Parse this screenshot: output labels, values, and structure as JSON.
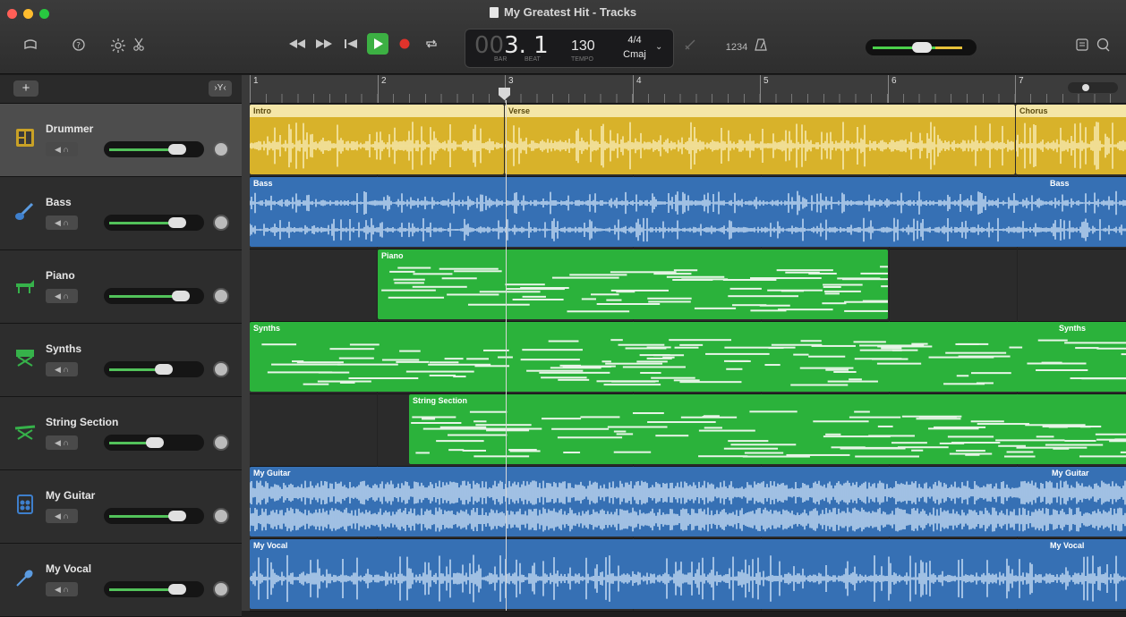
{
  "window": {
    "title": "My Greatest Hit - Tracks"
  },
  "colors": {
    "drummer": "#d8b22a",
    "audio": "#3670b4",
    "midi": "#2bb23b",
    "record": "#e0332b",
    "play": "#3cb043"
  },
  "toolbar": {
    "left_icons": [
      "library-icon",
      "help-icon",
      "smart-controls-icon",
      "editors-icon"
    ],
    "right_icons": [
      "notepad-icon",
      "loops-icon"
    ]
  },
  "lcd": {
    "bar_dim": "00",
    "position": "3. 1",
    "bar_label": "BAR",
    "beat_label": "BEAT",
    "tempo": "130",
    "tempo_label": "TEMPO",
    "time_sig": "4/4",
    "key": "Cmaj"
  },
  "count_in": {
    "label": "1234"
  },
  "tracks_header": {
    "add_label": "+",
    "smart_label": "›Y‹"
  },
  "ruler": {
    "bars": [
      "1",
      "2",
      "3",
      "4",
      "5",
      "6",
      "7"
    ]
  },
  "tracks": [
    {
      "name": "Drummer",
      "icon": "drummer-icon",
      "level": 0.72,
      "selected": true
    },
    {
      "name": "Bass",
      "icon": "bass-guitar-icon",
      "level": 0.72
    },
    {
      "name": "Piano",
      "icon": "piano-icon",
      "level": 0.76
    },
    {
      "name": "Synths",
      "icon": "synth-keyboard-icon",
      "level": 0.55
    },
    {
      "name": "String Section",
      "icon": "string-section-icon",
      "level": 0.45
    },
    {
      "name": "My Guitar",
      "icon": "amp-icon",
      "level": 0.72
    },
    {
      "name": "My Vocal",
      "icon": "microphone-icon",
      "level": 0.72
    }
  ],
  "regions": {
    "drummer": [
      "Intro",
      "Verse",
      "Chorus"
    ],
    "bass": [
      "Bass",
      "Bass"
    ],
    "piano": [
      "Piano"
    ],
    "synths": [
      "Synths",
      "Synths"
    ],
    "strings": [
      "String Section"
    ],
    "guitar": [
      "My Guitar",
      "My Guitar"
    ],
    "vocal": [
      "My Vocal",
      "My Vocal"
    ]
  }
}
